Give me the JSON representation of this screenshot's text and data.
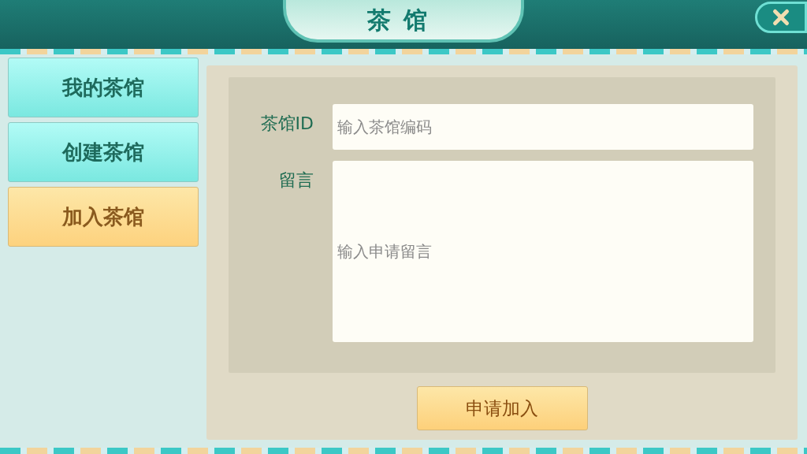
{
  "header": {
    "title": "茶馆"
  },
  "sidebar": {
    "items": [
      {
        "label": "我的茶馆",
        "selected": false
      },
      {
        "label": "创建茶馆",
        "selected": false
      },
      {
        "label": "加入茶馆",
        "selected": true
      }
    ]
  },
  "form": {
    "fields": [
      {
        "label": "茶馆ID",
        "placeholder": "输入茶馆编码",
        "kind": "line"
      },
      {
        "label": "留言",
        "placeholder": "输入申请留言",
        "kind": "area"
      }
    ],
    "submit": "申请加入"
  }
}
